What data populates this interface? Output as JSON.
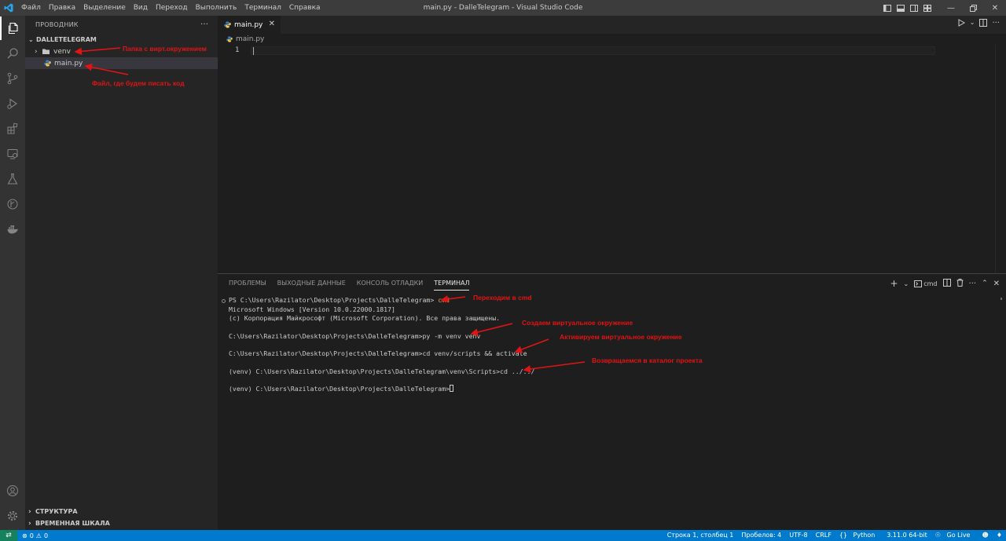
{
  "titlebar": {
    "menu": [
      "Файл",
      "Правка",
      "Выделение",
      "Вид",
      "Переход",
      "Выполнить",
      "Терминал",
      "Справка"
    ],
    "title": "main.py - DalleTelegram - Visual Studio Code"
  },
  "sidebar": {
    "header": "ПРОВОДНИК",
    "folder": "DALLETELEGRAM",
    "items": [
      {
        "label": "venv",
        "type": "folder"
      },
      {
        "label": "main.py",
        "type": "python-file"
      }
    ],
    "outline": "СТРУКТУРА",
    "timeline": "ВРЕМЕННАЯ ШКАЛА"
  },
  "editor": {
    "tab_label": "main.py",
    "breadcrumb": "main.py",
    "line_number": "1"
  },
  "panel": {
    "tabs": [
      "ПРОБЛЕМЫ",
      "ВЫХОДНЫЕ ДАННЫЕ",
      "КОНСОЛЬ ОТЛАДКИ",
      "ТЕРМИНАЛ"
    ],
    "active_tab": "ТЕРМИНАЛ",
    "terminal_name": "cmd",
    "terminal": {
      "l1_prompt": "PS C:\\Users\\Razilator\\Desktop\\Projects\\DalleTelegram> ",
      "l1_cmd": "cmd",
      "l2": "Microsoft Windows [Version 10.0.22000.1817]",
      "l3": "(c) Корпорация Майкрософт (Microsoft Corporation). Все права защищены.",
      "l4": "C:\\Users\\Razilator\\Desktop\\Projects\\DalleTelegram>py -m venv venv",
      "l5": "C:\\Users\\Razilator\\Desktop\\Projects\\DalleTelegram>cd venv/scripts && activate",
      "l6": "(venv) C:\\Users\\Razilator\\Desktop\\Projects\\DalleTelegram\\venv\\Scripts>cd ../../",
      "l7": "(venv) C:\\Users\\Razilator\\Desktop\\Projects\\DalleTelegram>"
    }
  },
  "annotations": {
    "venv": "Папка с вирт.окружением",
    "main": "Файл, где будем писать код",
    "cmd": "Переходим в cmd",
    "create": "Создаем виртуальное окружение",
    "activate": "Активируем виртуальное окружение",
    "return": "Возвращаемся в каталог проекта"
  },
  "statusbar": {
    "errors": "0",
    "warnings": "0",
    "position": "Строка 1, столбец 1",
    "spaces": "Пробелов: 4",
    "encoding": "UTF-8",
    "eol": "CRLF",
    "language": "Python",
    "interpreter": "3.11.0 64-bit",
    "golive": "Go Live"
  },
  "colors": {
    "statusbar": "#007acc",
    "remote": "#16825d",
    "annotation": "#e01414"
  }
}
